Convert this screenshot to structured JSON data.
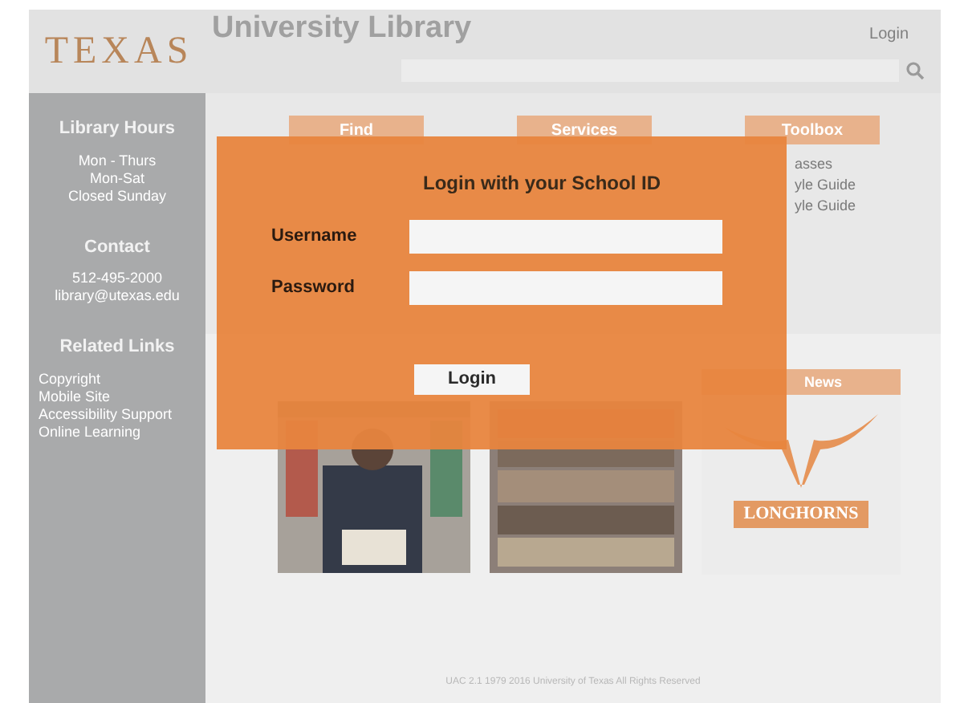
{
  "header": {
    "logo": "TEXAS",
    "title": "University Library",
    "login_link": "Login"
  },
  "sidebar": {
    "sections": [
      {
        "heading": "Library Hours",
        "kind": "info",
        "lines": [
          "Mon - Thurs",
          "Mon-Sat",
          "Closed Sunday"
        ]
      },
      {
        "heading": "Contact",
        "kind": "info",
        "lines": [
          "512-495-2000",
          "library@utexas.edu"
        ]
      },
      {
        "heading": "Related Links",
        "kind": "links",
        "lines": [
          "Copyright",
          "Mobile Site",
          "Accessibility Support",
          "Online Learning"
        ]
      }
    ]
  },
  "tabs": [
    {
      "label": "Find"
    },
    {
      "label": "Services"
    },
    {
      "label": "Toolbox"
    }
  ],
  "toolbox_links": [
    "asses",
    "yle Guide",
    "yle Guide"
  ],
  "cards": [
    {
      "kind": "picture"
    },
    {
      "kind": "picture"
    },
    {
      "kind": "logo",
      "heading": "News",
      "logo_text": "LONGHORNS"
    }
  ],
  "footer": "UAC 2.1 1979 2016 University of Texas All Rights Reserved",
  "modal": {
    "title": "Login with your School ID",
    "fields": [
      {
        "label": "Username"
      },
      {
        "label": "Password"
      }
    ],
    "button": "Login"
  }
}
